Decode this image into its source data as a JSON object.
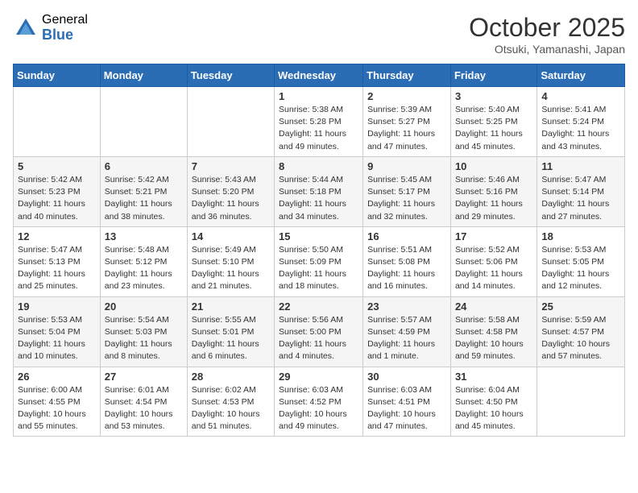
{
  "header": {
    "logo_general": "General",
    "logo_blue": "Blue",
    "month_title": "October 2025",
    "location": "Otsuki, Yamanashi, Japan"
  },
  "weekdays": [
    "Sunday",
    "Monday",
    "Tuesday",
    "Wednesday",
    "Thursday",
    "Friday",
    "Saturday"
  ],
  "weeks": [
    [
      {
        "day": "",
        "info": ""
      },
      {
        "day": "",
        "info": ""
      },
      {
        "day": "",
        "info": ""
      },
      {
        "day": "1",
        "info": "Sunrise: 5:38 AM\nSunset: 5:28 PM\nDaylight: 11 hours\nand 49 minutes."
      },
      {
        "day": "2",
        "info": "Sunrise: 5:39 AM\nSunset: 5:27 PM\nDaylight: 11 hours\nand 47 minutes."
      },
      {
        "day": "3",
        "info": "Sunrise: 5:40 AM\nSunset: 5:25 PM\nDaylight: 11 hours\nand 45 minutes."
      },
      {
        "day": "4",
        "info": "Sunrise: 5:41 AM\nSunset: 5:24 PM\nDaylight: 11 hours\nand 43 minutes."
      }
    ],
    [
      {
        "day": "5",
        "info": "Sunrise: 5:42 AM\nSunset: 5:23 PM\nDaylight: 11 hours\nand 40 minutes."
      },
      {
        "day": "6",
        "info": "Sunrise: 5:42 AM\nSunset: 5:21 PM\nDaylight: 11 hours\nand 38 minutes."
      },
      {
        "day": "7",
        "info": "Sunrise: 5:43 AM\nSunset: 5:20 PM\nDaylight: 11 hours\nand 36 minutes."
      },
      {
        "day": "8",
        "info": "Sunrise: 5:44 AM\nSunset: 5:18 PM\nDaylight: 11 hours\nand 34 minutes."
      },
      {
        "day": "9",
        "info": "Sunrise: 5:45 AM\nSunset: 5:17 PM\nDaylight: 11 hours\nand 32 minutes."
      },
      {
        "day": "10",
        "info": "Sunrise: 5:46 AM\nSunset: 5:16 PM\nDaylight: 11 hours\nand 29 minutes."
      },
      {
        "day": "11",
        "info": "Sunrise: 5:47 AM\nSunset: 5:14 PM\nDaylight: 11 hours\nand 27 minutes."
      }
    ],
    [
      {
        "day": "12",
        "info": "Sunrise: 5:47 AM\nSunset: 5:13 PM\nDaylight: 11 hours\nand 25 minutes."
      },
      {
        "day": "13",
        "info": "Sunrise: 5:48 AM\nSunset: 5:12 PM\nDaylight: 11 hours\nand 23 minutes."
      },
      {
        "day": "14",
        "info": "Sunrise: 5:49 AM\nSunset: 5:10 PM\nDaylight: 11 hours\nand 21 minutes."
      },
      {
        "day": "15",
        "info": "Sunrise: 5:50 AM\nSunset: 5:09 PM\nDaylight: 11 hours\nand 18 minutes."
      },
      {
        "day": "16",
        "info": "Sunrise: 5:51 AM\nSunset: 5:08 PM\nDaylight: 11 hours\nand 16 minutes."
      },
      {
        "day": "17",
        "info": "Sunrise: 5:52 AM\nSunset: 5:06 PM\nDaylight: 11 hours\nand 14 minutes."
      },
      {
        "day": "18",
        "info": "Sunrise: 5:53 AM\nSunset: 5:05 PM\nDaylight: 11 hours\nand 12 minutes."
      }
    ],
    [
      {
        "day": "19",
        "info": "Sunrise: 5:53 AM\nSunset: 5:04 PM\nDaylight: 11 hours\nand 10 minutes."
      },
      {
        "day": "20",
        "info": "Sunrise: 5:54 AM\nSunset: 5:03 PM\nDaylight: 11 hours\nand 8 minutes."
      },
      {
        "day": "21",
        "info": "Sunrise: 5:55 AM\nSunset: 5:01 PM\nDaylight: 11 hours\nand 6 minutes."
      },
      {
        "day": "22",
        "info": "Sunrise: 5:56 AM\nSunset: 5:00 PM\nDaylight: 11 hours\nand 4 minutes."
      },
      {
        "day": "23",
        "info": "Sunrise: 5:57 AM\nSunset: 4:59 PM\nDaylight: 11 hours\nand 1 minute."
      },
      {
        "day": "24",
        "info": "Sunrise: 5:58 AM\nSunset: 4:58 PM\nDaylight: 10 hours\nand 59 minutes."
      },
      {
        "day": "25",
        "info": "Sunrise: 5:59 AM\nSunset: 4:57 PM\nDaylight: 10 hours\nand 57 minutes."
      }
    ],
    [
      {
        "day": "26",
        "info": "Sunrise: 6:00 AM\nSunset: 4:55 PM\nDaylight: 10 hours\nand 55 minutes."
      },
      {
        "day": "27",
        "info": "Sunrise: 6:01 AM\nSunset: 4:54 PM\nDaylight: 10 hours\nand 53 minutes."
      },
      {
        "day": "28",
        "info": "Sunrise: 6:02 AM\nSunset: 4:53 PM\nDaylight: 10 hours\nand 51 minutes."
      },
      {
        "day": "29",
        "info": "Sunrise: 6:03 AM\nSunset: 4:52 PM\nDaylight: 10 hours\nand 49 minutes."
      },
      {
        "day": "30",
        "info": "Sunrise: 6:03 AM\nSunset: 4:51 PM\nDaylight: 10 hours\nand 47 minutes."
      },
      {
        "day": "31",
        "info": "Sunrise: 6:04 AM\nSunset: 4:50 PM\nDaylight: 10 hours\nand 45 minutes."
      },
      {
        "day": "",
        "info": ""
      }
    ]
  ]
}
